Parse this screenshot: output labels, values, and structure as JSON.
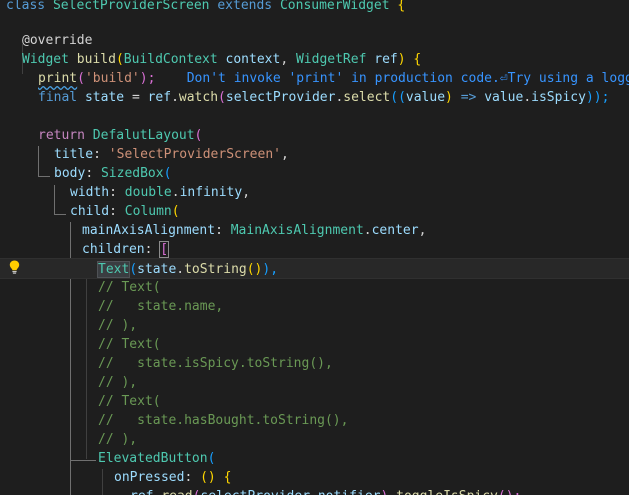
{
  "lines": {
    "l1": {
      "kw_class": "class",
      "cls_name": "SelectProviderScreen",
      "kw_extends": "extends",
      "cls_base": "ConsumerWidget",
      "brace": "{"
    },
    "l3": {
      "annotation": "@override"
    },
    "l4": {
      "type": "Widget",
      "name": "build",
      "p1": "(",
      "t1": "BuildContext",
      "a1": "context",
      "comma": ",",
      "t2": "WidgetRef",
      "a2": "ref",
      "p2": ")",
      "brace": "{"
    },
    "l5": {
      "fn": "print",
      "p1": "(",
      "str": "'build'",
      "p2": ");",
      "hint": "Don't invoke 'print' in production code.⏎Try using a logging framework."
    },
    "l6": {
      "kw": "final",
      "v": "state",
      "eq": "=",
      "ref": "ref",
      "dot1": ".",
      "fn": "watch",
      "p1": "(",
      "prov": "selectProvider",
      "dot2": ".",
      "fn2": "select",
      "p2": "((",
      "arg": "value",
      "p3": ")",
      "arrow": "=>",
      "v2": "value",
      "dot3": ".",
      "prop": "isSpicy",
      "p4": "));"
    },
    "l8": {
      "kw": "return",
      "cls": "DefalutLayout",
      "p": "("
    },
    "l9": {
      "prop": "title",
      "colon": ":",
      "str": "'SelectProviderScreen'",
      "comma": ","
    },
    "l10": {
      "prop": "body",
      "colon": ":",
      "cls": "SizedBox",
      "p": "("
    },
    "l11": {
      "prop": "width",
      "colon": ":",
      "t": "double",
      "dot": ".",
      "v": "infinity",
      "comma": ","
    },
    "l12": {
      "prop": "child",
      "colon": ":",
      "cls": "Column",
      "p": "("
    },
    "l13": {
      "prop": "mainAxisAlignment",
      "colon": ":",
      "cls": "MainAxisAlignment",
      "dot": ".",
      "v": "center",
      "comma": ","
    },
    "l14": {
      "prop": "children",
      "colon": ":",
      "br": "["
    },
    "l15": {
      "cls": "Text",
      "p1": "(",
      "v": "state",
      "dot": ".",
      "fn": "toString",
      "p2": "()",
      "p3": "),"
    },
    "l16": {
      "comment": "// Text("
    },
    "l17": {
      "comment": "//   state.name,"
    },
    "l18": {
      "comment": "// ),"
    },
    "l19": {
      "comment": "// Text("
    },
    "l20": {
      "comment": "//   state.isSpicy.toString(),"
    },
    "l21": {
      "comment": "// ),"
    },
    "l22": {
      "comment": "// Text("
    },
    "l23": {
      "comment": "//   state.hasBought.toString(),"
    },
    "l24": {
      "comment": "// ),"
    },
    "l25": {
      "cls": "ElevatedButton",
      "p": "("
    },
    "l26": {
      "prop": "onPressed",
      "colon": ":",
      "p1": "()",
      "brace": "{"
    },
    "l27": {
      "v": "ref",
      "dot1": ".",
      "fn": "read",
      "p1": "(",
      "prov": "selectProvider",
      "dot2": ".",
      "v2": "notifier",
      "p2": ")",
      "dot3": ".",
      "fn2": "toggleIsSpicy",
      "p3": "();"
    }
  },
  "colors": {
    "background": "#1e1e1e",
    "keyword": "#569cd6",
    "control": "#c586c0",
    "class": "#4ec9b0",
    "function": "#dcdcaa",
    "variable": "#9cdcfe",
    "string": "#ce9178",
    "comment": "#6a9955",
    "hint": "#3794ff"
  },
  "icons": {
    "gutter": "lightbulb-icon"
  }
}
